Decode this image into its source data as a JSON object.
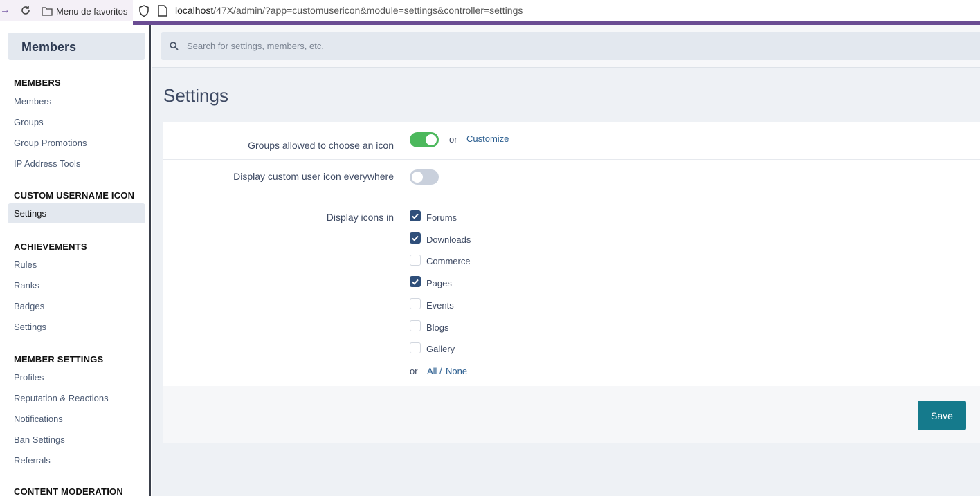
{
  "browser": {
    "bookmarks_label": "Menu de favoritos",
    "url_host": "localhost",
    "url_path": "/47X/admin/?app=customusericon&module=settings&controller=settings"
  },
  "sidebar": {
    "header": "Members",
    "sections": [
      {
        "title": "MEMBERS",
        "items": [
          "Members",
          "Groups",
          "Group Promotions",
          "IP Address Tools"
        ]
      },
      {
        "title": "CUSTOM USERNAME ICON",
        "items": [
          "Settings"
        ]
      },
      {
        "title": "ACHIEVEMENTS",
        "items": [
          "Rules",
          "Ranks",
          "Badges",
          "Settings"
        ]
      },
      {
        "title": "MEMBER SETTINGS",
        "items": [
          "Profiles",
          "Reputation & Reactions",
          "Notifications",
          "Ban Settings",
          "Referrals"
        ]
      },
      {
        "title": "CONTENT MODERATION",
        "items": []
      }
    ],
    "active_item": "Settings"
  },
  "search": {
    "placeholder": "Search for settings, members, etc."
  },
  "page": {
    "title": "Settings"
  },
  "form": {
    "groups_icon": {
      "label": "Groups allowed to choose an icon",
      "enabled": true,
      "or": "or",
      "customize": "Customize"
    },
    "display_everywhere": {
      "label": "Display custom user icon everywhere",
      "enabled": false
    },
    "display_in": {
      "label": "Display icons in",
      "options": [
        {
          "label": "Forums",
          "checked": true
        },
        {
          "label": "Downloads",
          "checked": true
        },
        {
          "label": "Commerce",
          "checked": false
        },
        {
          "label": "Pages",
          "checked": true
        },
        {
          "label": "Events",
          "checked": false
        },
        {
          "label": "Blogs",
          "checked": false
        },
        {
          "label": "Gallery",
          "checked": false
        }
      ],
      "or": "or",
      "all": "All",
      "separator": "/",
      "none": "None"
    },
    "save_label": "Save"
  },
  "colors": {
    "accent": "#6a4c93",
    "toggle_on": "#4cb85c",
    "checkbox": "#2f4f7a",
    "save": "#157a8c",
    "link": "#2a5d8f"
  }
}
